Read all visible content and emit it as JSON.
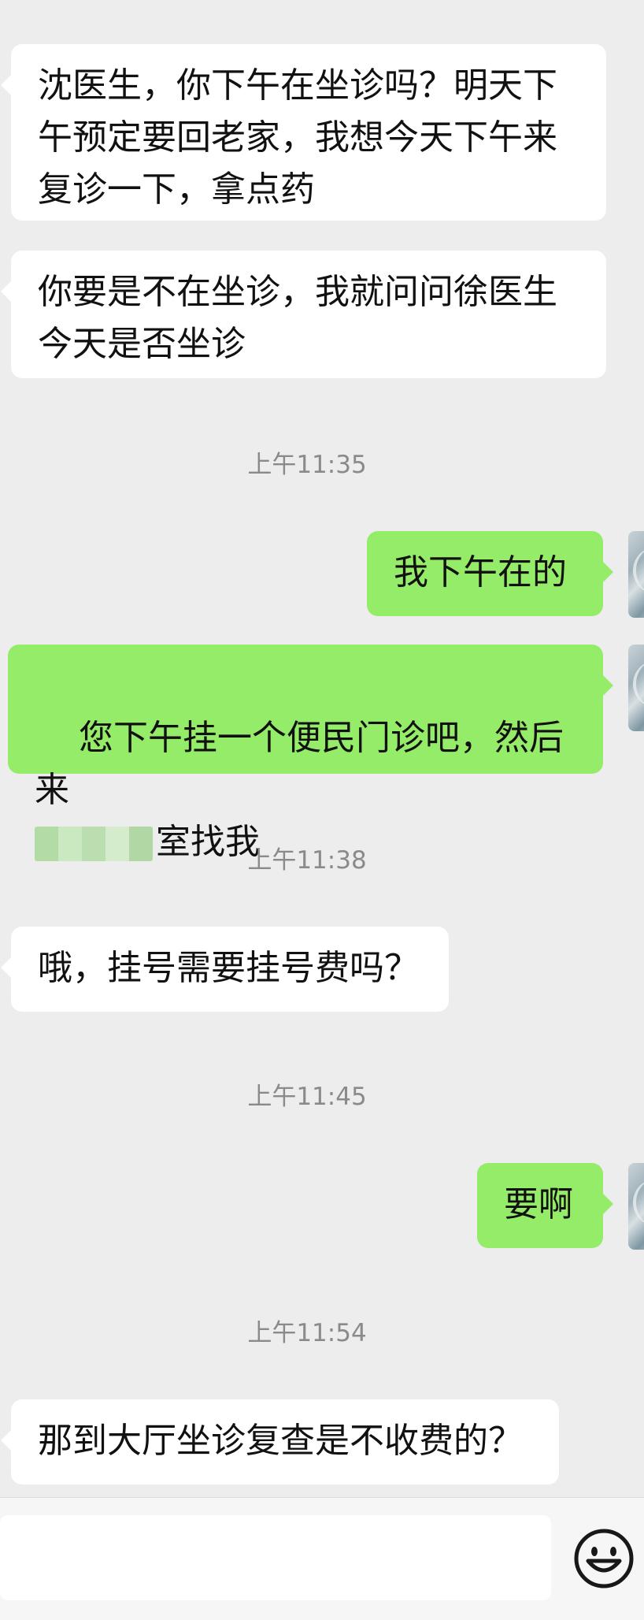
{
  "conversation": {
    "messages": [
      {
        "side": "in",
        "text": "沈医生，你下午在坐诊吗？明天下\n午预定要回老家，我想今天下午来\n复诊一下，拿点药"
      },
      {
        "side": "in",
        "text": "你要是不在坐诊，我就问问徐医生\n今天是否坐诊"
      },
      {
        "side": "out",
        "text": "我下午在的"
      },
      {
        "side": "out",
        "text_line1": "您下午挂一个便民门诊吧，然后来",
        "text_line2": "室找我"
      },
      {
        "side": "in",
        "text": "哦，挂号需要挂号费吗？"
      },
      {
        "side": "out",
        "text": "要啊"
      },
      {
        "side": "in",
        "text": "那到大厅坐诊复查是不收费的？"
      }
    ],
    "timestamps": [
      "上午11:35",
      "上午11:38",
      "上午11:45",
      "上午11:54"
    ]
  },
  "input": {
    "value": "",
    "placeholder": ""
  },
  "icons": {
    "emoji": "emoji-smile-icon"
  },
  "colors": {
    "background": "#ededed",
    "incoming_bubble": "#ffffff",
    "outgoing_bubble": "#95ec69",
    "timestamp": "#8a8a8a"
  }
}
